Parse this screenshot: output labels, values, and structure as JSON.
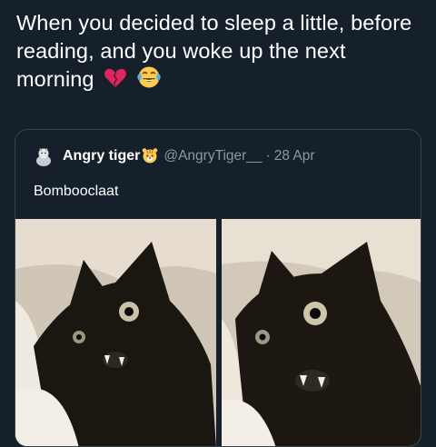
{
  "post": {
    "text": "When you decided to sleep a little, before reading, and you woke up the next morning",
    "emojis": [
      "broken-heart-icon",
      "tears-of-joy-icon"
    ]
  },
  "quoted_tweet": {
    "display_name": "Angry tiger",
    "name_emoji": "tiger-face-icon",
    "handle": "@AngryTiger__",
    "separator": "·",
    "date": "28 Apr",
    "text": "Bombooclaat",
    "avatar_icon": "avatar-icon",
    "photos": [
      "cat-photo-icon",
      "cat-photo-icon"
    ]
  },
  "colors": {
    "background": "#15202b",
    "text": "#ffffff",
    "muted": "#8899a6",
    "border": "#38444d"
  }
}
